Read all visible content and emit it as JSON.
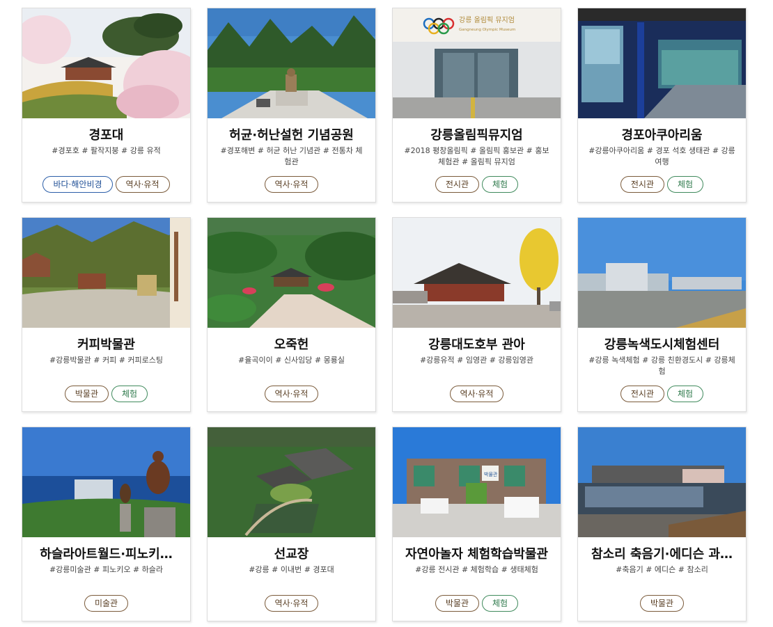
{
  "cards": [
    {
      "title": "경포대",
      "tags": "#경포호 # 팔작지붕 # 강릉 유적",
      "badges": [
        {
          "label": "바다·해안비경",
          "type": "sea"
        },
        {
          "label": "역사·유적",
          "type": "hist"
        }
      ]
    },
    {
      "title": "허균·허난설헌 기념공원",
      "tags": "#경포해변 # 허균 허난 기념관 # 전통차 체험관",
      "badges": [
        {
          "label": "역사·유적",
          "type": "hist"
        }
      ]
    },
    {
      "title": "강릉올림픽뮤지엄",
      "tags": "#2018 평창올림픽 # 올림픽 홍보관 # 홍보체험관 # 올림픽 뮤지엄",
      "badges": [
        {
          "label": "전시관",
          "type": "hist"
        },
        {
          "label": "체험",
          "type": "exp"
        }
      ]
    },
    {
      "title": "경포아쿠아리움",
      "tags": "#강릉아쿠아리움 # 경포 석호 생태관 # 강릉여행",
      "badges": [
        {
          "label": "전시관",
          "type": "hist"
        },
        {
          "label": "체험",
          "type": "exp"
        }
      ]
    },
    {
      "title": "커피박물관",
      "tags": "#강릉박물관 # 커피 # 커피로스팅",
      "badges": [
        {
          "label": "박물관",
          "type": "hist"
        },
        {
          "label": "체험",
          "type": "exp"
        }
      ]
    },
    {
      "title": "오죽헌",
      "tags": "#율곡이이 # 신사임당 # 몽룡실",
      "badges": [
        {
          "label": "역사·유적",
          "type": "hist"
        }
      ]
    },
    {
      "title": "강릉대도호부 관아",
      "tags": "#강릉유적 # 임영관 # 강릉임영관",
      "badges": [
        {
          "label": "역사·유적",
          "type": "hist"
        }
      ]
    },
    {
      "title": "강릉녹색도시체험센터",
      "tags": "#강릉 녹색체험 # 강릉 친환경도시 # 강릉체험",
      "badges": [
        {
          "label": "전시관",
          "type": "hist"
        },
        {
          "label": "체험",
          "type": "exp"
        }
      ]
    },
    {
      "title": "하슬라아트월드·피노키…",
      "tags": "#강릉미술관 # 피노키오 # 하슬라",
      "badges": [
        {
          "label": "미술관",
          "type": "hist"
        }
      ]
    },
    {
      "title": "선교장",
      "tags": "#강릉 # 이내번 # 경포대",
      "badges": [
        {
          "label": "역사·유적",
          "type": "hist"
        }
      ]
    },
    {
      "title": "자연아놀자 체험학습박물관",
      "tags": "#강릉 전시관 # 체험학습 # 생태체험",
      "badges": [
        {
          "label": "박물관",
          "type": "hist"
        },
        {
          "label": "체험",
          "type": "exp"
        }
      ]
    },
    {
      "title": "참소리 축음기·에디슨 과…",
      "tags": "#축음기 # 에디슨 # 참소리",
      "badges": [
        {
          "label": "박물관",
          "type": "hist"
        }
      ]
    }
  ],
  "photo_signs": {
    "olympic_museum_sign": "강릉 올림픽 뮤지엄",
    "olympic_museum_sign_en": "Gangneung Olympic Museum",
    "nature_museum_sign": "박물관"
  }
}
